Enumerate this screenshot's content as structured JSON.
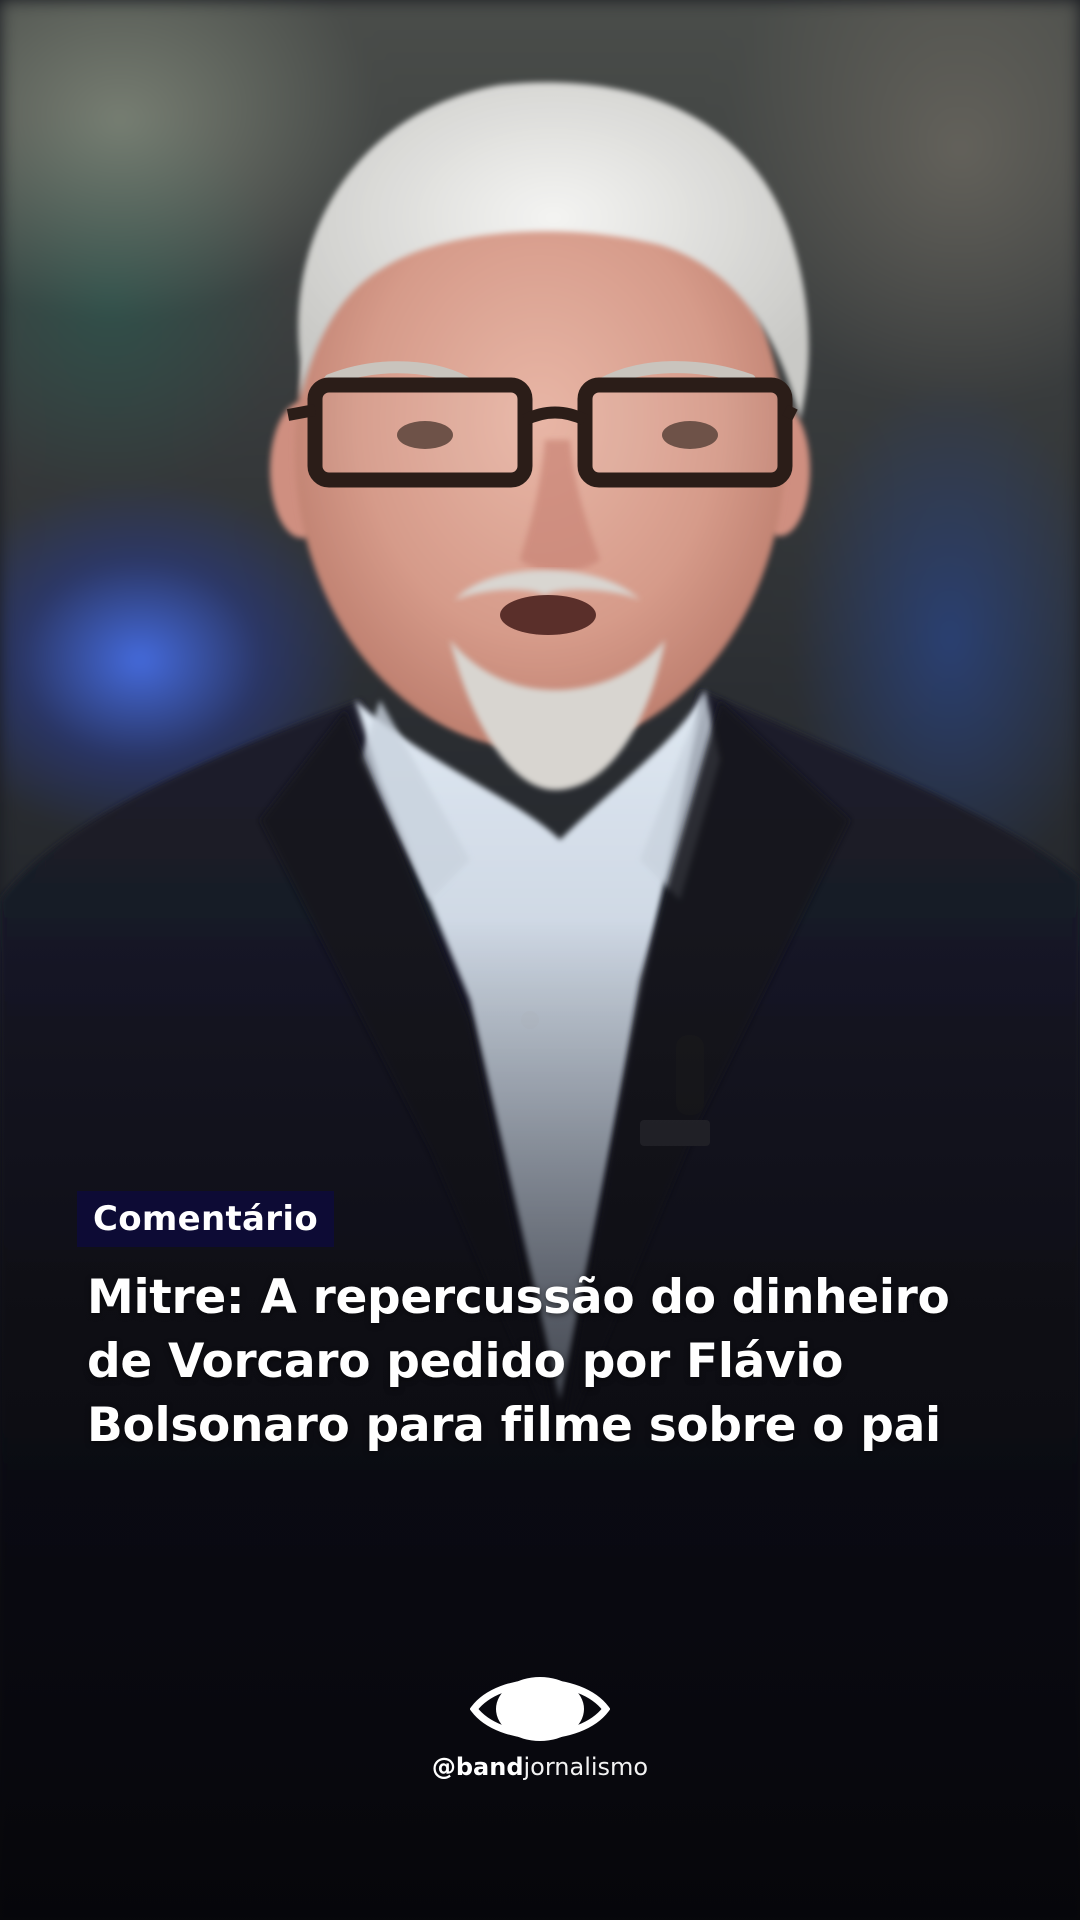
{
  "overlay": {
    "tag_label": "Comentário",
    "tag_color": "#0d0b35",
    "headline_lines": [
      "Mitre: A repercussão do dinheiro",
      "de Vorcaro pedido por Flávio",
      "Bolsonaro para filme sobre o pai"
    ]
  },
  "branding": {
    "logo_icon": "band-eye-logo-icon",
    "handle_prefix": "@",
    "handle_bold": "band",
    "handle_light": "jornalismo"
  },
  "scene": {
    "subject": "presenter-photo",
    "background_accent": "#3b5bd6"
  }
}
